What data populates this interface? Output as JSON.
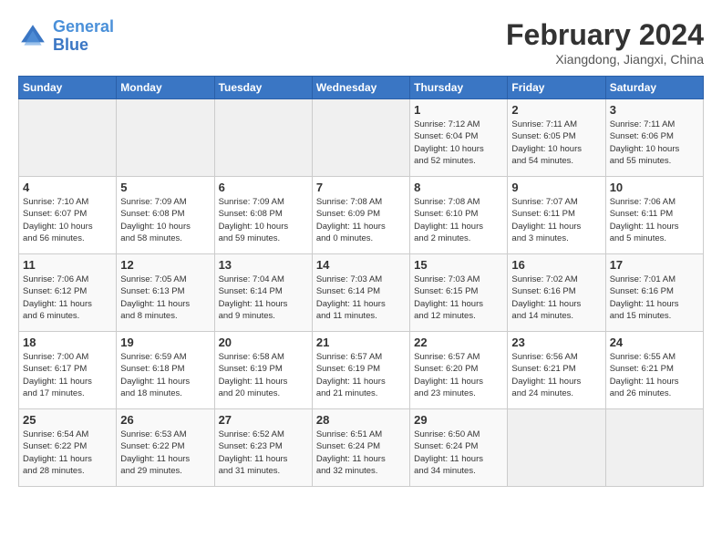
{
  "header": {
    "logo_line1": "General",
    "logo_line2": "Blue",
    "month_title": "February 2024",
    "subtitle": "Xiangdong, Jiangxi, China"
  },
  "days_of_week": [
    "Sunday",
    "Monday",
    "Tuesday",
    "Wednesday",
    "Thursday",
    "Friday",
    "Saturday"
  ],
  "weeks": [
    [
      {
        "day": "",
        "info": ""
      },
      {
        "day": "",
        "info": ""
      },
      {
        "day": "",
        "info": ""
      },
      {
        "day": "",
        "info": ""
      },
      {
        "day": "1",
        "info": "Sunrise: 7:12 AM\nSunset: 6:04 PM\nDaylight: 10 hours\nand 52 minutes."
      },
      {
        "day": "2",
        "info": "Sunrise: 7:11 AM\nSunset: 6:05 PM\nDaylight: 10 hours\nand 54 minutes."
      },
      {
        "day": "3",
        "info": "Sunrise: 7:11 AM\nSunset: 6:06 PM\nDaylight: 10 hours\nand 55 minutes."
      }
    ],
    [
      {
        "day": "4",
        "info": "Sunrise: 7:10 AM\nSunset: 6:07 PM\nDaylight: 10 hours\nand 56 minutes."
      },
      {
        "day": "5",
        "info": "Sunrise: 7:09 AM\nSunset: 6:08 PM\nDaylight: 10 hours\nand 58 minutes."
      },
      {
        "day": "6",
        "info": "Sunrise: 7:09 AM\nSunset: 6:08 PM\nDaylight: 10 hours\nand 59 minutes."
      },
      {
        "day": "7",
        "info": "Sunrise: 7:08 AM\nSunset: 6:09 PM\nDaylight: 11 hours\nand 0 minutes."
      },
      {
        "day": "8",
        "info": "Sunrise: 7:08 AM\nSunset: 6:10 PM\nDaylight: 11 hours\nand 2 minutes."
      },
      {
        "day": "9",
        "info": "Sunrise: 7:07 AM\nSunset: 6:11 PM\nDaylight: 11 hours\nand 3 minutes."
      },
      {
        "day": "10",
        "info": "Sunrise: 7:06 AM\nSunset: 6:11 PM\nDaylight: 11 hours\nand 5 minutes."
      }
    ],
    [
      {
        "day": "11",
        "info": "Sunrise: 7:06 AM\nSunset: 6:12 PM\nDaylight: 11 hours\nand 6 minutes."
      },
      {
        "day": "12",
        "info": "Sunrise: 7:05 AM\nSunset: 6:13 PM\nDaylight: 11 hours\nand 8 minutes."
      },
      {
        "day": "13",
        "info": "Sunrise: 7:04 AM\nSunset: 6:14 PM\nDaylight: 11 hours\nand 9 minutes."
      },
      {
        "day": "14",
        "info": "Sunrise: 7:03 AM\nSunset: 6:14 PM\nDaylight: 11 hours\nand 11 minutes."
      },
      {
        "day": "15",
        "info": "Sunrise: 7:03 AM\nSunset: 6:15 PM\nDaylight: 11 hours\nand 12 minutes."
      },
      {
        "day": "16",
        "info": "Sunrise: 7:02 AM\nSunset: 6:16 PM\nDaylight: 11 hours\nand 14 minutes."
      },
      {
        "day": "17",
        "info": "Sunrise: 7:01 AM\nSunset: 6:16 PM\nDaylight: 11 hours\nand 15 minutes."
      }
    ],
    [
      {
        "day": "18",
        "info": "Sunrise: 7:00 AM\nSunset: 6:17 PM\nDaylight: 11 hours\nand 17 minutes."
      },
      {
        "day": "19",
        "info": "Sunrise: 6:59 AM\nSunset: 6:18 PM\nDaylight: 11 hours\nand 18 minutes."
      },
      {
        "day": "20",
        "info": "Sunrise: 6:58 AM\nSunset: 6:19 PM\nDaylight: 11 hours\nand 20 minutes."
      },
      {
        "day": "21",
        "info": "Sunrise: 6:57 AM\nSunset: 6:19 PM\nDaylight: 11 hours\nand 21 minutes."
      },
      {
        "day": "22",
        "info": "Sunrise: 6:57 AM\nSunset: 6:20 PM\nDaylight: 11 hours\nand 23 minutes."
      },
      {
        "day": "23",
        "info": "Sunrise: 6:56 AM\nSunset: 6:21 PM\nDaylight: 11 hours\nand 24 minutes."
      },
      {
        "day": "24",
        "info": "Sunrise: 6:55 AM\nSunset: 6:21 PM\nDaylight: 11 hours\nand 26 minutes."
      }
    ],
    [
      {
        "day": "25",
        "info": "Sunrise: 6:54 AM\nSunset: 6:22 PM\nDaylight: 11 hours\nand 28 minutes."
      },
      {
        "day": "26",
        "info": "Sunrise: 6:53 AM\nSunset: 6:22 PM\nDaylight: 11 hours\nand 29 minutes."
      },
      {
        "day": "27",
        "info": "Sunrise: 6:52 AM\nSunset: 6:23 PM\nDaylight: 11 hours\nand 31 minutes."
      },
      {
        "day": "28",
        "info": "Sunrise: 6:51 AM\nSunset: 6:24 PM\nDaylight: 11 hours\nand 32 minutes."
      },
      {
        "day": "29",
        "info": "Sunrise: 6:50 AM\nSunset: 6:24 PM\nDaylight: 11 hours\nand 34 minutes."
      },
      {
        "day": "",
        "info": ""
      },
      {
        "day": "",
        "info": ""
      }
    ]
  ]
}
